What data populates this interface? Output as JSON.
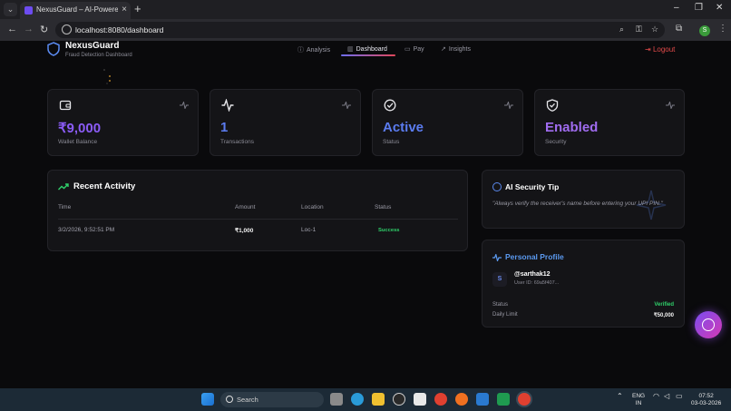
{
  "browser": {
    "tab_title": "NexusGuard – AI-Powered UPI",
    "tab_close": "×",
    "new_tab": "+",
    "url": "localhost:8080/dashboard",
    "profile_initial": "S",
    "window_controls": [
      "–",
      "❐",
      "✕"
    ]
  },
  "header": {
    "brand": "NexusGuard",
    "subtitle": "Fraud Detection Dashboard",
    "nav": [
      {
        "label": "Analysis",
        "icon": "analysis-icon"
      },
      {
        "label": "Dashboard",
        "icon": "bar-chart-icon",
        "active": true
      },
      {
        "label": "Pay",
        "icon": "card-icon"
      },
      {
        "label": "Insights",
        "icon": "insights-icon"
      }
    ],
    "logout_label": "Logout"
  },
  "stats": [
    {
      "value": "₹9,000",
      "label": "Wallet Balance",
      "icon": "wallet-icon",
      "color": "#8b5cf6"
    },
    {
      "value": "1",
      "label": "Transactions",
      "icon": "activity-icon",
      "color": "#5b7cf0"
    },
    {
      "value": "Active",
      "label": "Status",
      "icon": "check-circle-icon",
      "color": "#5b7cf0"
    },
    {
      "value": "Enabled",
      "label": "Security",
      "icon": "shield-check-icon",
      "color": "#a06cf0"
    }
  ],
  "recent_activity": {
    "title": "Recent Activity",
    "columns": [
      "Time",
      "Amount",
      "Location",
      "Status"
    ],
    "rows": [
      {
        "time": "3/2/2026, 9:52:51 PM",
        "amount": "₹1,000",
        "location": "Loc-1",
        "status": "Success"
      }
    ]
  },
  "security_tip": {
    "title": "AI Security Tip",
    "text": "\"Always verify the receiver's name before entering your UPI PIN.\""
  },
  "profile": {
    "title": "Personal Profile",
    "avatar": "S",
    "username": "@sarthak12",
    "user_id": "User ID: 69a5f407...",
    "status_label": "Status",
    "status_value": "Verified",
    "limit_label": "Daily Limit",
    "limit_value": "₹50,000"
  },
  "taskbar": {
    "search_placeholder": "Search",
    "lang": "ENG",
    "region": "IN",
    "time": "07:52",
    "date": "03-03-2026"
  },
  "colors": {
    "accent": "#6d6df0",
    "success": "#2fd06a",
    "danger": "#e24a4a"
  }
}
